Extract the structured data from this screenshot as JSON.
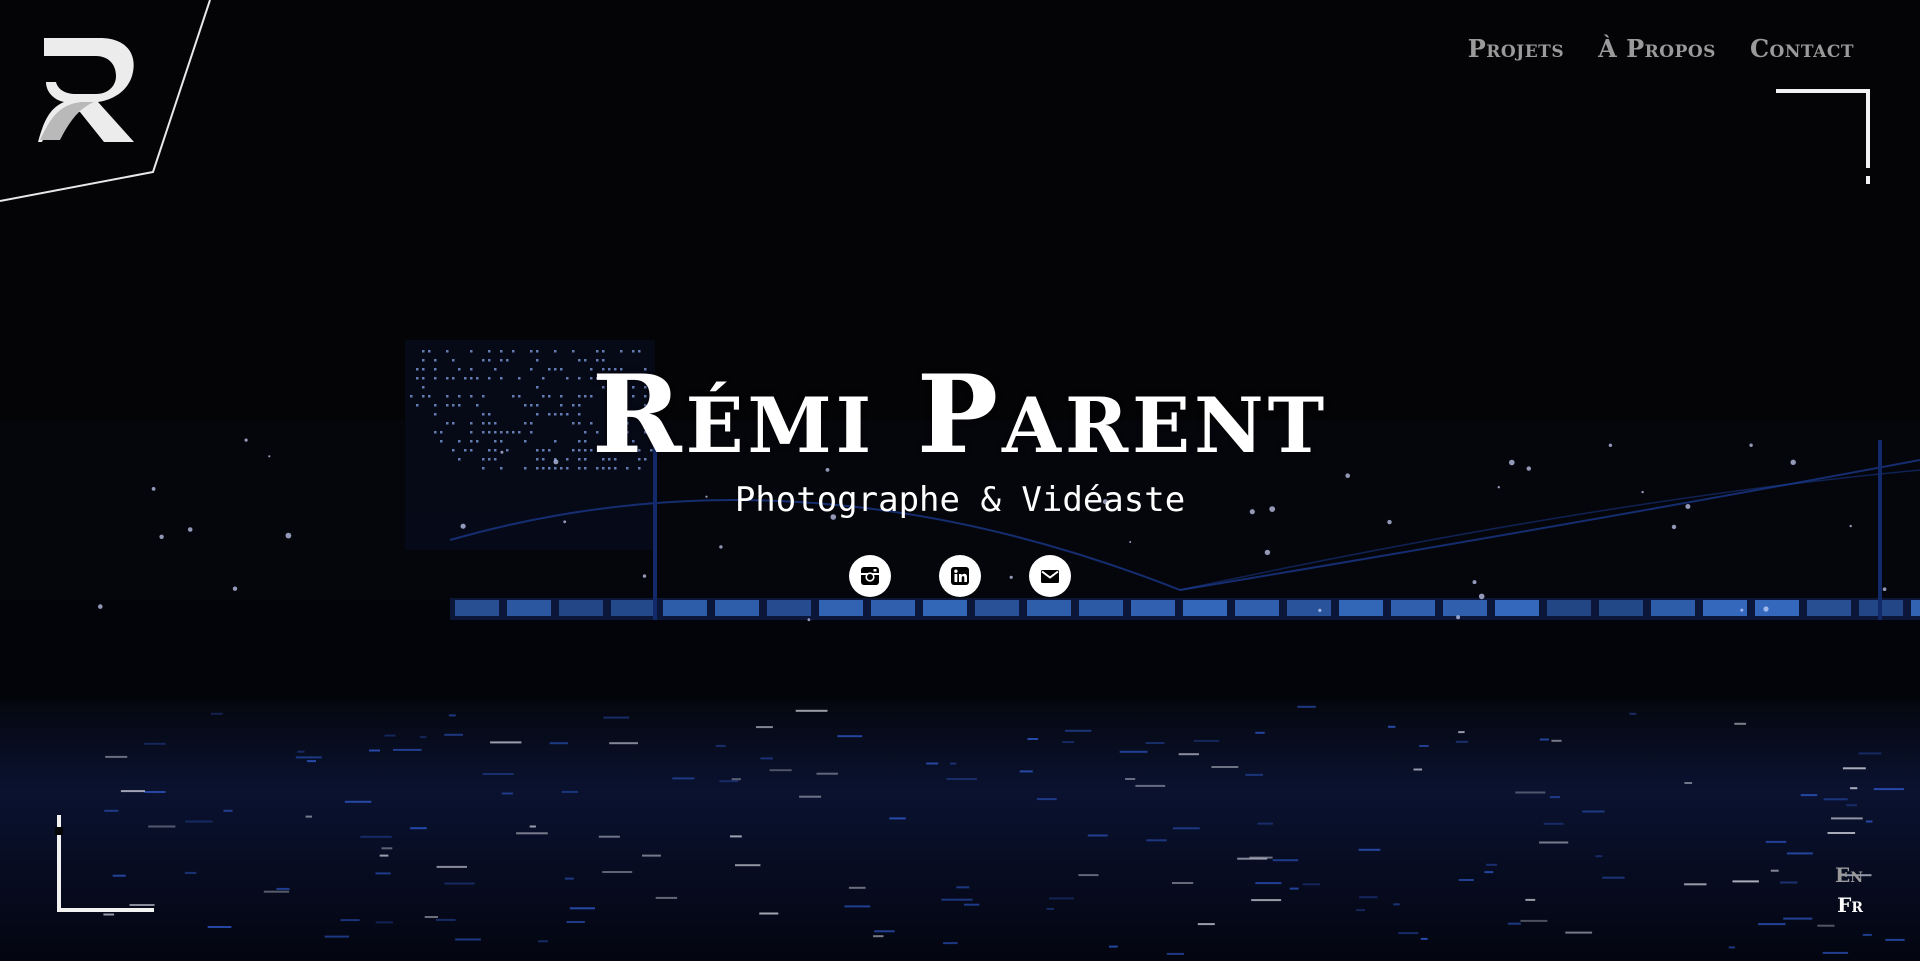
{
  "nav": {
    "items": [
      {
        "label": "Projets"
      },
      {
        "label": "À Propos"
      },
      {
        "label": "Contact"
      }
    ]
  },
  "hero": {
    "title": "Rémi Parent",
    "subtitle": "Photographe & Vidéaste"
  },
  "socials": [
    {
      "icon": "instagram-icon"
    },
    {
      "icon": "linkedin-icon"
    },
    {
      "icon": "email-icon"
    }
  ],
  "language": {
    "options": [
      "En",
      "Fr"
    ],
    "selected": "Fr"
  },
  "colors": {
    "background": "#040406",
    "text": "#ffffff",
    "nav_text": "#9a9a9a",
    "bridge_light": "#3f7fe0"
  }
}
